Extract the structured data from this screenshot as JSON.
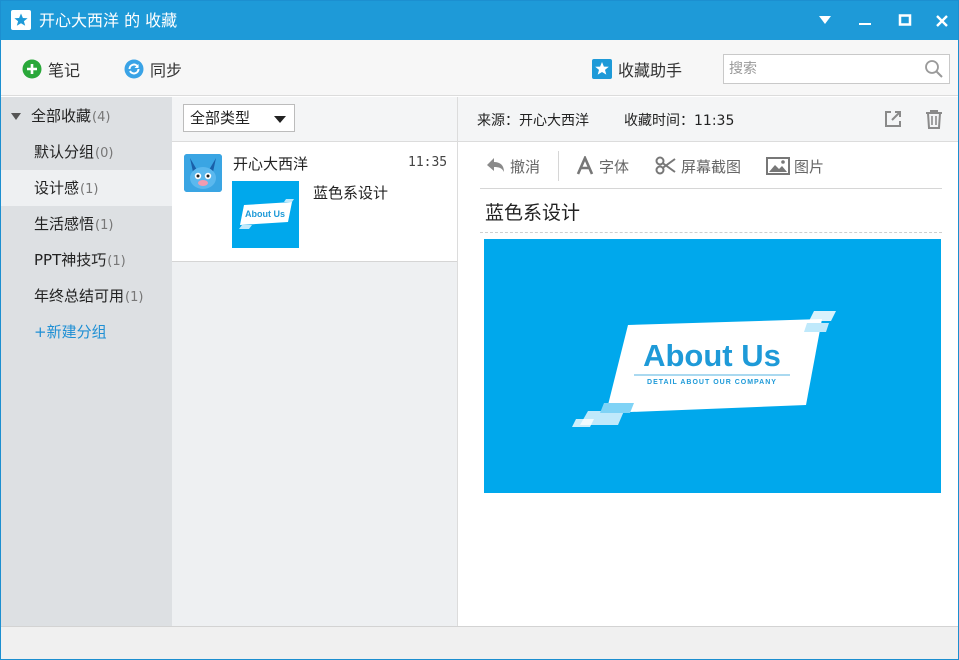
{
  "window": {
    "title": "开心大西洋 的 收藏",
    "accent": "#1e9ad8"
  },
  "toolbar": {
    "note_label": "笔记",
    "sync_label": "同步",
    "assistant_label": "收藏助手",
    "search_placeholder": "搜索"
  },
  "sidebar": {
    "all": {
      "label": "全部收藏",
      "count": "(4)"
    },
    "items": [
      {
        "label": "默认分组",
        "count": "(0)"
      },
      {
        "label": "设计感",
        "count": "(1)"
      },
      {
        "label": "生活感悟",
        "count": "(1)"
      },
      {
        "label": "PPT神技巧",
        "count": "(1)"
      },
      {
        "label": "年终总结可用",
        "count": "(1)"
      }
    ],
    "new_group_label": "+新建分组"
  },
  "list": {
    "filter_label": "全部类型",
    "note": {
      "author": "开心大西洋",
      "time": "11:35",
      "title": "蓝色系设计",
      "thumb_text": "About Us"
    }
  },
  "detail": {
    "source": "来源：开心大西洋",
    "collect_time": "收藏时间：11:35",
    "toolbar": {
      "undo": "撤消",
      "font": "字体",
      "screenshot": "屏幕截图",
      "image": "图片"
    },
    "doc_title": "蓝色系设计",
    "image_heading": "About Us",
    "image_subheading": "DETAIL ABOUT OUR COMPANY"
  }
}
